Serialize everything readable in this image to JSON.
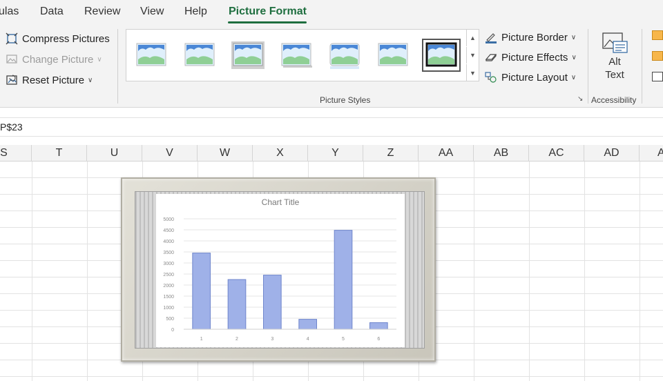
{
  "tabs": [
    {
      "label": "ulas"
    },
    {
      "label": "Data"
    },
    {
      "label": "Review"
    },
    {
      "label": "View"
    },
    {
      "label": "Help"
    },
    {
      "label": "Picture Format",
      "active": true
    }
  ],
  "ribbon": {
    "adjust": {
      "compress": "Compress Pictures",
      "change": "Change Picture",
      "reset": "Reset Picture"
    },
    "styles_group_label": "Picture Styles",
    "style_thumbs": [
      "simple-frame-white",
      "simple-frame-soft",
      "beveled-matte",
      "drop-shadow-rectangle",
      "reflected-rounded",
      "soft-edge-rectangle",
      "thick-matte-black"
    ],
    "style_selected_index": 6,
    "border": "Picture Border",
    "effects": "Picture Effects",
    "layout": "Picture Layout",
    "alt_text": {
      "line1": "Alt",
      "line2": "Text"
    },
    "accessibility_label": "Accessibility"
  },
  "formula_bar": {
    "cell_ref": "P$23"
  },
  "columns": [
    "S",
    "T",
    "U",
    "V",
    "W",
    "X",
    "Y",
    "Z",
    "AA",
    "AB",
    "AC",
    "AD",
    "A"
  ],
  "chart_data": {
    "type": "bar",
    "title": "Chart Title",
    "categories": [
      "1",
      "2",
      "3",
      "4",
      "5",
      "6"
    ],
    "values": [
      3450,
      2250,
      2450,
      450,
      4480,
      300
    ],
    "ylim": [
      0,
      5000
    ],
    "yticks": [
      "0",
      "500",
      "1000",
      "1500",
      "2000",
      "2500",
      "3000",
      "3500",
      "4000",
      "4500",
      "5000"
    ],
    "grid": true,
    "colors": {
      "bar_fill": "#9fb1e8",
      "bar_stroke": "#6f86cc"
    }
  },
  "colors": {
    "accent": "#1e6e3f"
  }
}
